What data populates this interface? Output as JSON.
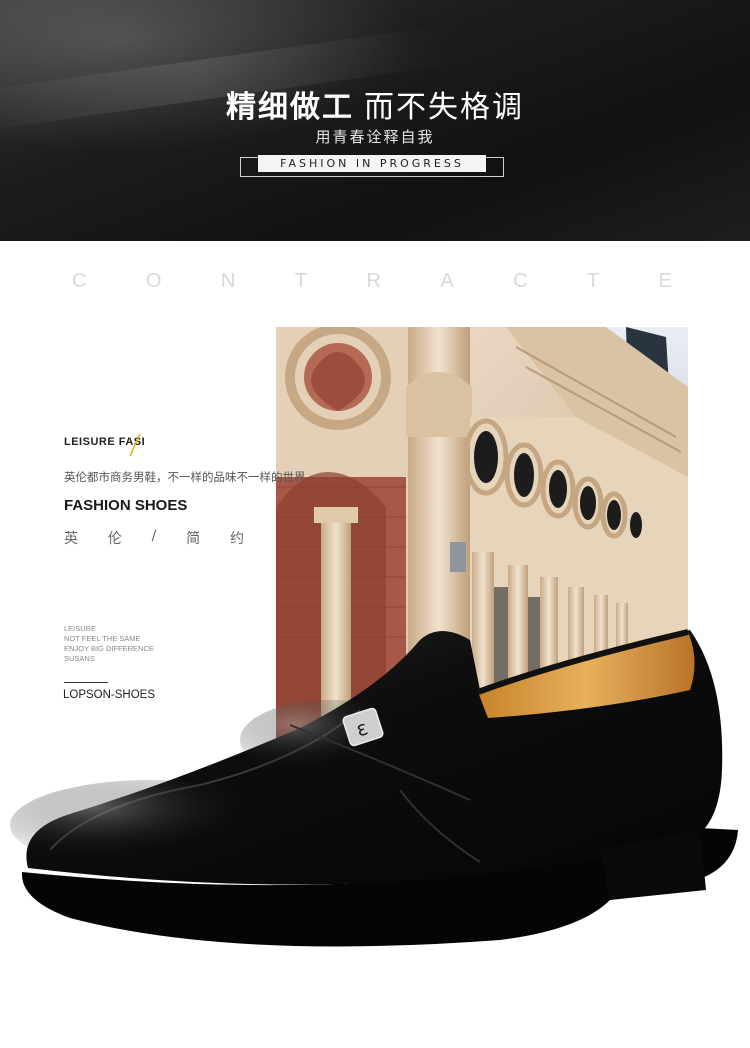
{
  "banner": {
    "title_bold": "精细做工",
    "title_light": "而不失格调",
    "subtitle": "用青春诠释自我",
    "tag": "FASHION IN PROGRESS"
  },
  "watermark": {
    "letters": [
      "C",
      "O",
      "N",
      "T",
      "R",
      "A",
      "C",
      "T",
      "E"
    ]
  },
  "left_panel": {
    "heading": "LEISURE FASI",
    "description": "英伦都市商务男鞋，不一样的品味不一样的世界",
    "title": "FASHION SHOES",
    "cn_chars": [
      "英",
      "伦",
      "/",
      "简",
      "约"
    ],
    "small_lines": [
      "LEISURE",
      "NOT FEEL THE SAME",
      "ENJOY BIG DIFFERENCE",
      "SUSANS"
    ],
    "brand": "LOPSON-SHOES"
  },
  "colors": {
    "banner_dark": "#111112",
    "accent_slash": "#e0b200",
    "leather": "#0b0b0b",
    "lining": "#d89a3c"
  },
  "images": {
    "building": "european-building-photo",
    "shoe": "black-leather-slip-on-shoe",
    "emblem": "brand-emblem-icon"
  }
}
